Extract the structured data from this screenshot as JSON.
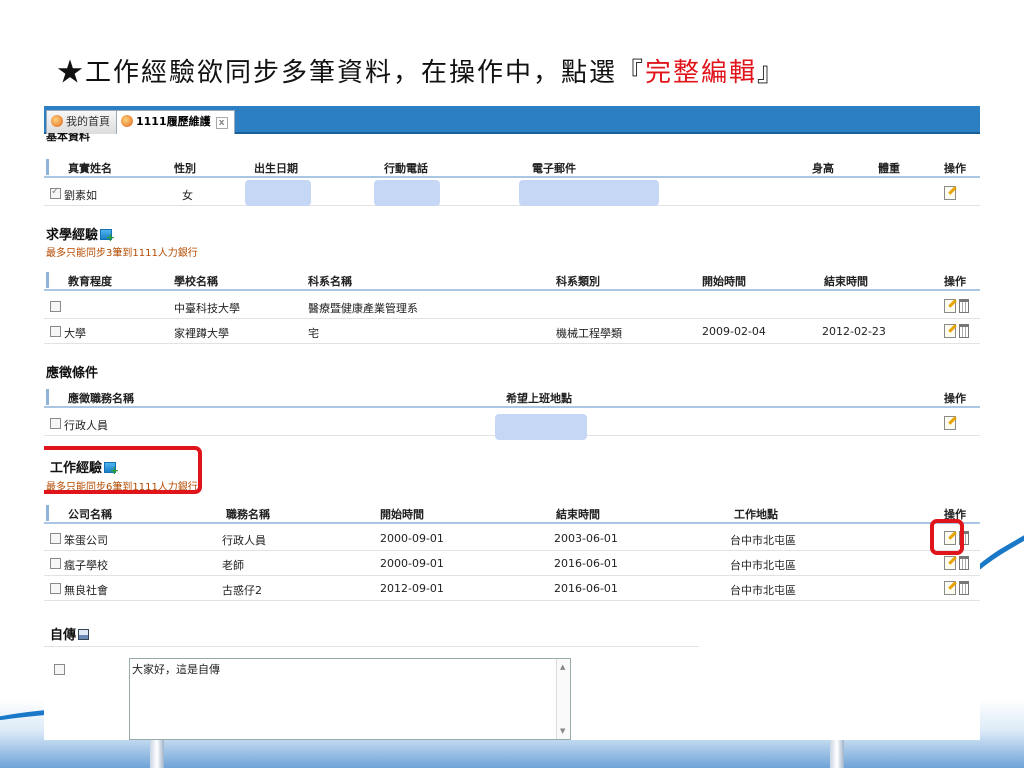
{
  "slide": {
    "title_main": "★工作經驗欲同步多筆資料，在操作中，點選『",
    "title_highlight": "完整編輯",
    "title_end": "』"
  },
  "tabs": [
    {
      "label": "我的首頁",
      "active": false
    },
    {
      "label": "1111履歷維護",
      "active": true,
      "close": "x"
    }
  ],
  "basic": {
    "title": "基本資料",
    "headers": [
      "真實姓名",
      "性別",
      "出生日期",
      "行動電話",
      "電子郵件",
      "身高",
      "體重",
      "操作"
    ],
    "row": {
      "name": "劉素如",
      "gender": "女"
    }
  },
  "education": {
    "title": "求學經驗",
    "note": "最多只能同步3筆到1111人力銀行",
    "headers": [
      "教育程度",
      "學校名稱",
      "科系名稱",
      "科系類別",
      "開始時間",
      "結束時間",
      "操作"
    ],
    "rows": [
      {
        "level": "",
        "school": "中臺科技大學",
        "dept": "醫療暨健康產業管理系",
        "category": "",
        "start": "",
        "end": ""
      },
      {
        "level": "大學",
        "school": "家裡蹲大學",
        "dept": "宅",
        "category": "機械工程學類",
        "start": "2009-02-04",
        "end": "2012-02-23"
      }
    ]
  },
  "job_conditions": {
    "title": "應徵條件",
    "headers": [
      "應徵職務名稱",
      "希望上班地點",
      "操作"
    ],
    "rows": [
      {
        "job": "行政人員"
      }
    ]
  },
  "work": {
    "title": "工作經驗",
    "note": "最多只能同步6筆到1111人力銀行",
    "headers": [
      "公司名稱",
      "職務名稱",
      "開始時間",
      "結束時間",
      "工作地點",
      "操作"
    ],
    "rows": [
      {
        "company": "笨蛋公司",
        "job": "行政人員",
        "start": "2000-09-01",
        "end": "2003-06-01",
        "location": "台中市北屯區"
      },
      {
        "company": "瘋子學校",
        "job": "老師",
        "start": "2000-09-01",
        "end": "2016-06-01",
        "location": "台中市北屯區"
      },
      {
        "company": "無良社會",
        "job": "古惑仔2",
        "start": "2012-09-01",
        "end": "2016-06-01",
        "location": "台中市北屯區"
      }
    ]
  },
  "bio": {
    "title": "自傳",
    "text": "大家好，這是自傳"
  },
  "colors": {
    "tab_bar": "#2b7fc2",
    "highlight": "#e0141b",
    "note": "#b54a00",
    "mask": "#c6d7f5"
  }
}
